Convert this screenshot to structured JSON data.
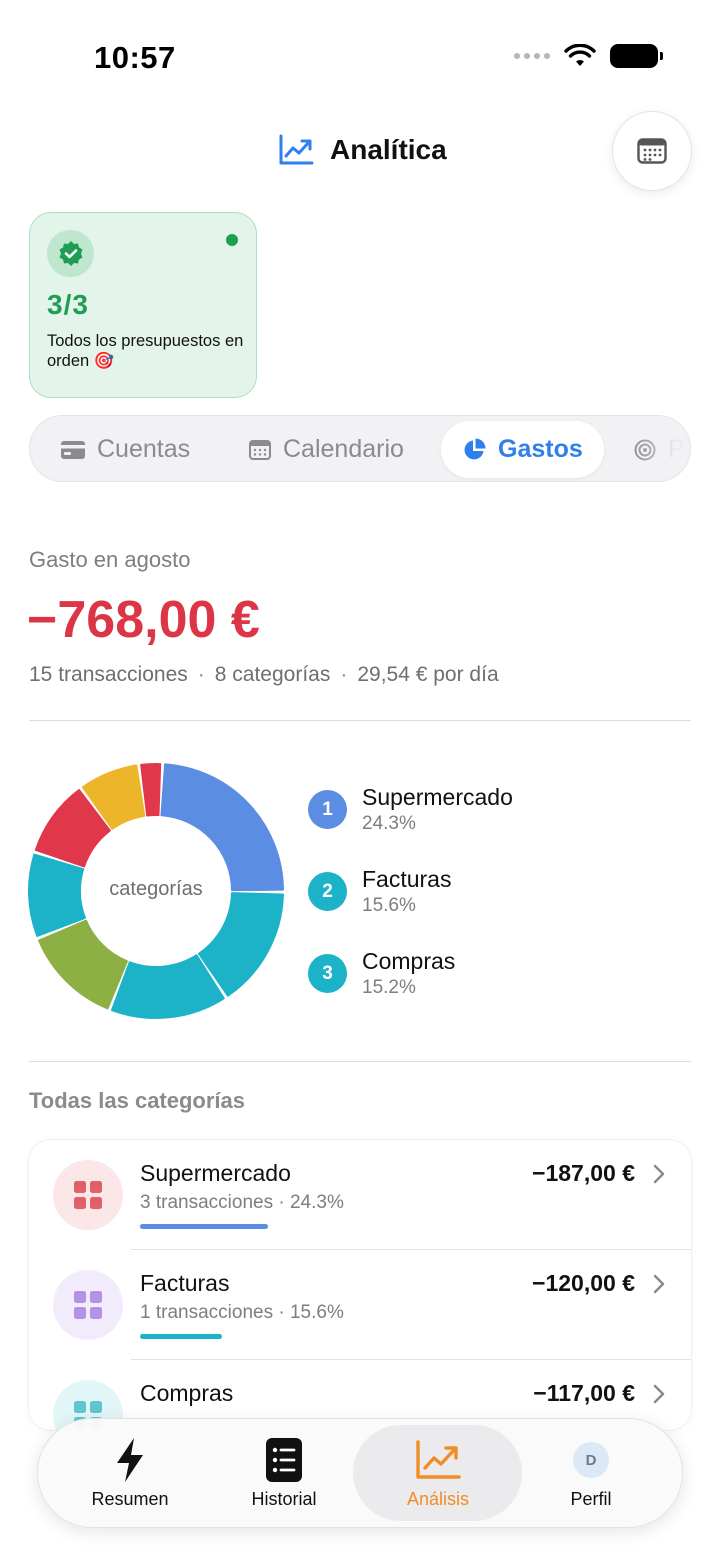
{
  "status_bar": {
    "time": "10:57"
  },
  "header": {
    "title": "Analítica",
    "icon": "trending-up-icon",
    "action_icon": "calendar-icon"
  },
  "budget_card": {
    "count": "3/3",
    "text": "Todos los presupuestos en orden 🎯",
    "accent": "#1e9e54",
    "background": "#e3f4ea"
  },
  "tabs": [
    {
      "label": "Cuentas",
      "icon": "credit-card-icon",
      "active": false
    },
    {
      "label": "Calendario",
      "icon": "calendar-icon",
      "active": false
    },
    {
      "label": "Gastos",
      "icon": "pie-chart-icon",
      "active": true
    },
    {
      "label": "P",
      "icon": "target-icon",
      "active": false
    }
  ],
  "spending": {
    "label": "Gasto en agosto",
    "amount": "−768,00 €",
    "amount_color": "#dc3545",
    "transactions": "15 transacciones",
    "categories": "8 categorías",
    "per_day": "29,54 € por día"
  },
  "donut": {
    "center_label": "categorías",
    "segments": [
      {
        "color": "#5b8de3",
        "pct": 24.3
      },
      {
        "color": "#1cb3c9",
        "pct": 15.6
      },
      {
        "color": "#1cb3c9",
        "pct": 15.2
      },
      {
        "color": "#8db045",
        "pct": 13.0
      },
      {
        "color": "#1cb3c9",
        "pct": 11.0
      },
      {
        "color": "#e0374a",
        "pct": 10.0
      },
      {
        "color": "#ecb52a",
        "pct": 7.9
      },
      {
        "color": "#e0374a",
        "pct": 3.0
      }
    ]
  },
  "legend": [
    {
      "rank": "1",
      "name": "Supermercado",
      "pct": "24.3%",
      "color": "#5b8de3"
    },
    {
      "rank": "2",
      "name": "Facturas",
      "pct": "15.6%",
      "color": "#1cb3c9"
    },
    {
      "rank": "3",
      "name": "Compras",
      "pct": "15.2%",
      "color": "#1cb3c9"
    }
  ],
  "all_categories": {
    "title": "Todas las categorías",
    "items": [
      {
        "name": "Supermercado",
        "sub": "3 transacciones · 24.3%",
        "amount": "−187,00 €",
        "bar_color": "#5b8de3",
        "share": 0.243,
        "icon_bg": "#fbe7e7",
        "icon_color": "#e0606a",
        "icon": "grid-icon"
      },
      {
        "name": "Facturas",
        "sub": "1 transacciones · 15.6%",
        "amount": "−120,00 €",
        "bar_color": "#1cb3c9",
        "share": 0.156,
        "icon_bg": "#f1ebfb",
        "icon_color": "#b391e6",
        "icon": "grid-icon"
      },
      {
        "name": "Compras",
        "sub": "",
        "amount": "−117,00 €",
        "bar_color": "#1cb3c9",
        "share": 0.152,
        "icon_bg": "#e3f6f7",
        "icon_color": "#5fc7cf",
        "icon": "grid-icon"
      }
    ]
  },
  "bottom_nav": [
    {
      "label": "Resumen",
      "icon": "bolt-icon",
      "active": false
    },
    {
      "label": "Historial",
      "icon": "list-icon",
      "active": false
    },
    {
      "label": "Análisis",
      "icon": "trending-up-icon",
      "active": true,
      "accent": "#f28c28"
    },
    {
      "label": "Perfil",
      "icon": "avatar",
      "avatar_letter": "D",
      "active": false
    }
  ]
}
